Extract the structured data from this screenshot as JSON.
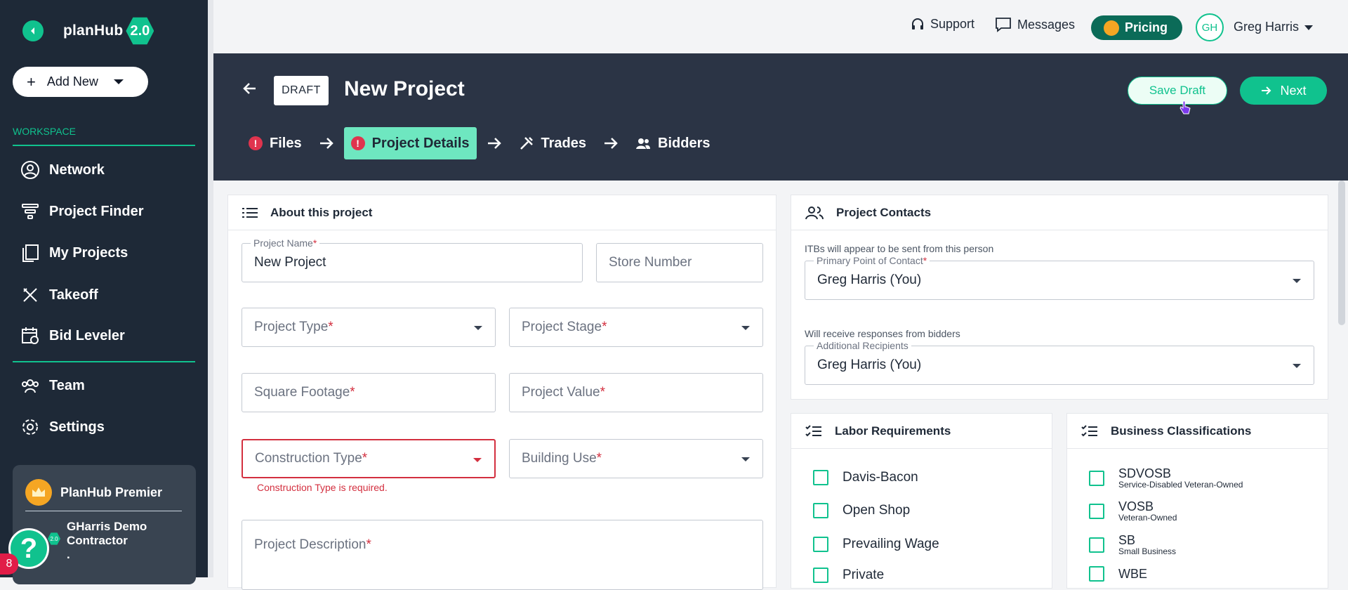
{
  "sidebar": {
    "logo_text": "planHub",
    "logo_version": "2.0",
    "add_new_label": "Add New",
    "workspace_label": "WORKSPACE",
    "nav": [
      {
        "label": "Network",
        "icon": "user-circle-icon"
      },
      {
        "label": "Project Finder",
        "icon": "funnel-icon"
      },
      {
        "label": "My Projects",
        "icon": "documents-icon"
      },
      {
        "label": "Takeoff",
        "icon": "ruler-pencil-icon"
      },
      {
        "label": "Bid Leveler",
        "icon": "calendar-scale-icon"
      },
      {
        "label": "Team",
        "icon": "team-icon"
      },
      {
        "label": "Settings",
        "icon": "gear-icon"
      }
    ],
    "premium_label": "PlanHub Premier",
    "company_name": "GHarris Demo Contractor",
    "company_extra": ".",
    "help_label": "?",
    "notification_count": "8",
    "mini_badge": "2.0"
  },
  "topbar": {
    "support_label": "Support",
    "messages_label": "Messages",
    "pricing_label": "Pricing",
    "avatar_initials": "GH",
    "user_name": "Greg Harris"
  },
  "header": {
    "draft_tag": "DRAFT",
    "title": "New Project",
    "save_draft_label": "Save Draft",
    "next_label": "Next",
    "steps": [
      {
        "label": "Files",
        "has_error": true
      },
      {
        "label": "Project Details",
        "has_error": true,
        "active": true
      },
      {
        "label": "Trades"
      },
      {
        "label": "Bidders"
      }
    ],
    "error_mark": "!"
  },
  "about": {
    "title": "About this project",
    "project_name_label": "Project Name",
    "project_name_value": "New Project",
    "store_number_placeholder": "Store Number",
    "project_type_label": "Project Type",
    "project_stage_label": "Project Stage",
    "square_footage_label": "Square Footage",
    "project_value_label": "Project Value",
    "construction_type_label": "Construction Type",
    "construction_type_error": "Construction Type is required.",
    "building_use_label": "Building Use",
    "project_description_label": "Project Description",
    "required_mark": "*"
  },
  "contacts": {
    "title": "Project Contacts",
    "primary_helper": "ITBs will appear to be sent from this person",
    "primary_label": "Primary Point of Contact",
    "primary_value": "Greg Harris (You)",
    "additional_helper": "Will receive responses from bidders",
    "additional_label": "Additional Recipients",
    "additional_value": "Greg Harris (You)"
  },
  "labor": {
    "title": "Labor Requirements",
    "options": [
      "Davis-Bacon",
      "Open Shop",
      "Prevailing Wage",
      "Private"
    ]
  },
  "business": {
    "title": "Business Classifications",
    "options": [
      {
        "code": "SDVOSB",
        "desc": "Service-Disabled Veteran-Owned"
      },
      {
        "code": "VOSB",
        "desc": "Veteran-Owned"
      },
      {
        "code": "SB",
        "desc": "Small Business"
      },
      {
        "code": "WBE",
        "desc": ""
      }
    ]
  },
  "colors": {
    "accent": "#10c28e",
    "sidebar_bg": "#1e2937",
    "header_bg": "#2b3445",
    "error": "#d32f3f"
  }
}
